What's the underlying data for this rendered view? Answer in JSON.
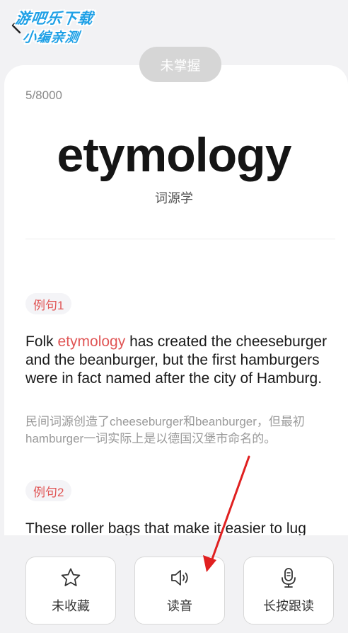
{
  "watermark": {
    "line1": "游吧乐下载",
    "line2": "小编亲测"
  },
  "status": "未掌握",
  "progress": "5/8000",
  "word": "etymology",
  "translation": "词源学",
  "examples": [
    {
      "tag": "例句1",
      "en_before": "Folk ",
      "en_highlight": "etymology",
      "en_after": " has created the cheeseburger and the beanburger, but the first hamburgers were in fact named after the city of Hamburg.",
      "cn": "民间词源创造了cheeseburger和beanburger，但最初hamburger一词实际上是以德国汉堡市命名的。"
    },
    {
      "tag": "例句2",
      "en": "These roller bags that make it easier to lug"
    }
  ],
  "actions": {
    "favorite": "未收藏",
    "pronounce": "读音",
    "follow_read": "长按跟读"
  },
  "colors": {
    "accent": "#e05555",
    "annotation_arrow": "#e02020",
    "pill_bg": "#d6d6d6"
  },
  "icons": {
    "back": "chevron-left-icon",
    "favorite": "star-icon",
    "pronounce": "speaker-icon",
    "follow_read": "microphone-icon"
  }
}
